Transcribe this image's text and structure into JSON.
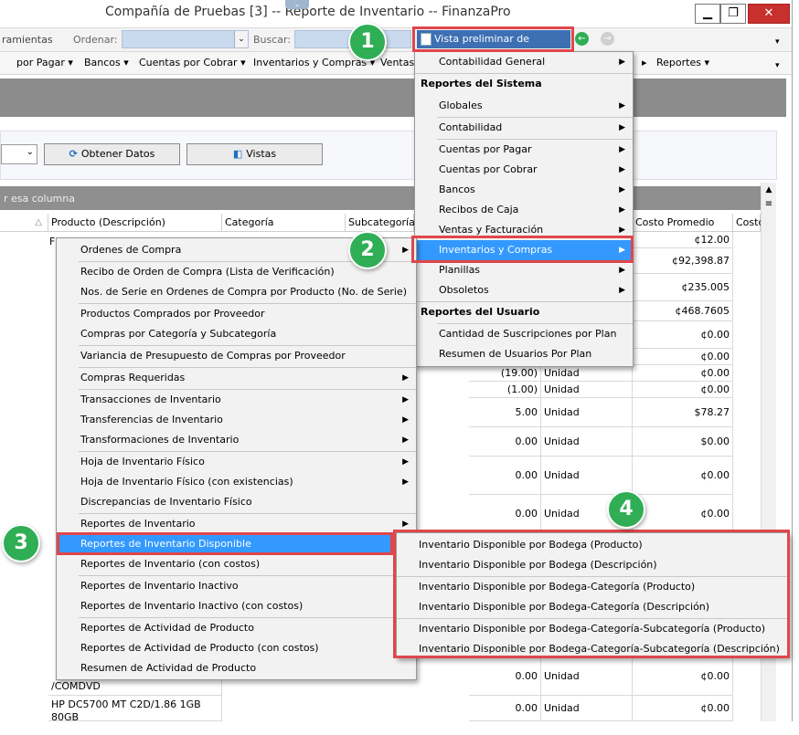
{
  "window": {
    "title": "Compañía de Pruebas [3] -- Reporte de Inventario -- FinanzaPro",
    "minimize": "▁",
    "maximize": "❐",
    "close": "✕"
  },
  "toolbar": {
    "tools_label": "ramientas",
    "order_label": "Ordenar:",
    "search_label": "Buscar:",
    "preview_label": "Vista preliminar de reportes"
  },
  "menubar": {
    "items": [
      "por Pagar ▾",
      "Bancos ▾",
      "Cuentas por Cobrar ▾",
      "Inventarios y Compras ▾",
      "Ventas",
      "▸",
      "Reportes ▾"
    ]
  },
  "controls": {
    "get_data": "Obtener Datos",
    "views": "Vistas",
    "group_hint": "r esa columna"
  },
  "grid": {
    "headers": [
      "Producto (Descripción)",
      "Categoría",
      "Subcategoría",
      "Costo Promedio",
      "Costo"
    ],
    "left_rows": [
      {
        "desc": "",
        "qty": "",
        "unit": "",
        "cost": "¢12.00"
      },
      {
        "desc": "",
        "qty": "",
        "unit": "",
        "cost": "¢92,398.87"
      },
      {
        "desc": "",
        "qty": "",
        "unit": "",
        "cost": "¢235.005"
      },
      {
        "desc": "",
        "qty": "",
        "unit": "",
        "cost": "¢468.7605"
      },
      {
        "desc": "",
        "qty": "",
        "unit": "",
        "cost": "¢0.00"
      },
      {
        "desc": "",
        "qty": "",
        "unit": "",
        "cost": "¢0.00"
      },
      {
        "desc": "",
        "qty": "(19.00)",
        "unit": "Unidad",
        "cost": "¢0.00"
      },
      {
        "desc": "",
        "qty": "(1.00)",
        "unit": "Unidad",
        "cost": "¢0.00"
      },
      {
        "desc": "",
        "qty": "5.00",
        "unit": "Unidad",
        "cost": "$78.27"
      },
      {
        "desc": "",
        "qty": "0.00",
        "unit": "Unidad",
        "cost": "$0.00"
      },
      {
        "desc": "",
        "qty": "0.00",
        "unit": "Unidad",
        "cost": "¢0.00"
      },
      {
        "desc": "",
        "qty": "0.00",
        "unit": "Unidad",
        "cost": "¢0.00"
      }
    ],
    "bottom_rows": [
      {
        "desc": "/COMDVD",
        "qty": "0.00",
        "unit": "Unidad",
        "cost": "¢0.00"
      },
      {
        "desc": "HP DC5700 MT C2D/1.86 1GB 80GB",
        "qty": "0.00",
        "unit": "Unidad",
        "cost": "¢0.00"
      }
    ]
  },
  "menu_reports": {
    "items": [
      {
        "label": "Contabilidad General",
        "arrow": "▶"
      },
      {
        "label": "Reportes del Sistema",
        "header": true
      },
      {
        "label": "Globales",
        "arrow": "▶"
      },
      {
        "label": "Contabilidad",
        "arrow": "▶"
      },
      {
        "label": "Cuentas por Pagar",
        "arrow": "▶"
      },
      {
        "label": "Cuentas por Cobrar",
        "arrow": "▶"
      },
      {
        "label": "Bancos",
        "arrow": "▶"
      },
      {
        "label": "Recibos de Caja",
        "arrow": "▶"
      },
      {
        "label": "Ventas y Facturación",
        "arrow": "▶"
      },
      {
        "label": "Inventarios y Compras",
        "arrow": "▶"
      },
      {
        "label": "Planillas",
        "arrow": "▶"
      },
      {
        "label": "Obsoletos",
        "arrow": "▶"
      },
      {
        "label": "Reportes del Usuario",
        "header": true
      },
      {
        "label": "Cantidad de Suscripciones por Plan"
      },
      {
        "label": "Resumen de Usuarios Por Plan"
      }
    ]
  },
  "menu_inventory": {
    "items": [
      {
        "label": "Ordenes de Compra",
        "arrow": "▶"
      },
      {
        "label": "Recibo de Orden de Compra (Lista de Verificación)"
      },
      {
        "label": "Nos. de Serie en Ordenes de Compra por Producto (No. de Serie)"
      },
      {
        "label": "Productos Comprados por Proveedor"
      },
      {
        "label": "Compras por Categoría y Subcategoría"
      },
      {
        "label": "Variancia de Presupuesto de Compras por Proveedor"
      },
      {
        "label": "Compras Requeridas",
        "arrow": "▶"
      },
      {
        "label": "Transacciones de Inventario",
        "arrow": "▶"
      },
      {
        "label": "Transferencias de Inventario",
        "arrow": "▶"
      },
      {
        "label": "Transformaciones de Inventario",
        "arrow": "▶"
      },
      {
        "label": "Hoja de Inventario Físico",
        "arrow": "▶"
      },
      {
        "label": "Hoja de Inventario Físico (con existencias)",
        "arrow": "▶"
      },
      {
        "label": "Discrepancias de Inventario Físico"
      },
      {
        "label": "Reportes de Inventario",
        "arrow": "▶"
      },
      {
        "label": "Reportes de Inventario Disponible",
        "arrow": "▶"
      },
      {
        "label": "Reportes de Inventario (con costos)",
        "arrow": "▶"
      },
      {
        "label": "Reportes de Inventario Inactivo"
      },
      {
        "label": "Reportes de Inventario Inactivo (con costos)"
      },
      {
        "label": "Reportes de Actividad de Producto"
      },
      {
        "label": "Reportes de Actividad de Producto (con costos)"
      },
      {
        "label": "Resumen de Actividad de Producto"
      }
    ]
  },
  "menu_available": {
    "items": [
      "Inventario Disponible por Bodega (Producto)",
      "Inventario Disponible por Bodega (Descripción)",
      "Inventario Disponible por Bodega-Categoría (Producto)",
      "Inventario Disponible por Bodega-Categoría (Descripción)",
      "Inventario Disponible por Bodega-Categoría-Subcategoría (Producto)",
      "Inventario Disponible por Bodega-Categoría-Subcategoría (Descripción)"
    ]
  },
  "badges": [
    "1",
    "2",
    "3",
    "4"
  ],
  "colors": {
    "highlight": "#3399ff",
    "callout": "#e0464b",
    "badge": "#2fae55"
  }
}
